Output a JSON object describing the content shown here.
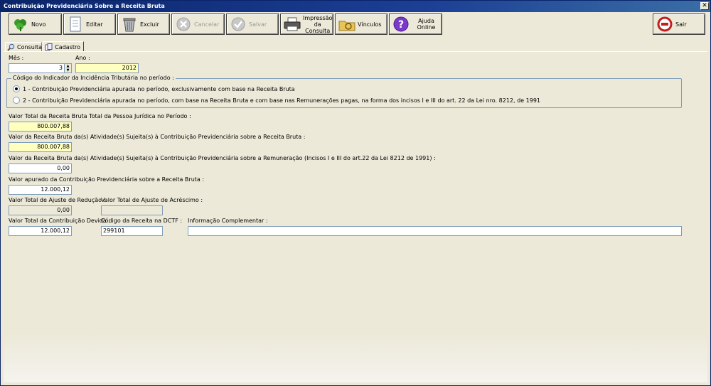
{
  "window": {
    "title": "Contribuição Previdenciária Sobre a Receita Bruta",
    "close_glyph": "✕"
  },
  "toolbar": {
    "novo": "Novo",
    "editar": "Editar",
    "excluir": "Excluir",
    "cancelar": "Cancelar",
    "salvar": "Salvar",
    "impressao_line1": "Impressão",
    "impressao_line2": "da Consulta",
    "vinculos": "Vínculos",
    "ajuda": "Ajuda Online",
    "sair": "Sair"
  },
  "tabs": {
    "consulta": "Consulta",
    "cadastro": "Cadastro"
  },
  "form": {
    "mes_label": "Mês :",
    "mes_value": "3",
    "ano_label": "Ano :",
    "ano_value": "2012",
    "indicador": {
      "legend": "Código do Indicador da Incidência Tributária no período :",
      "option1": "1 - Contribuição Previdenciária apurada no período, exclusivamente com base na Receita Bruta",
      "option2": "2 - Contribuição Previdenciária apurada no período, com base na Receita Bruta e com base nas Remunerações pagas, na forma dos  incisos I e III do art. 22 da Lei nro. 8212, de 1991",
      "selected": 1
    },
    "receita_total_label": "Valor Total da Receita Bruta Total da Pessoa Jurídica no Período :",
    "receita_total_value": "800.007,88",
    "receita_atividades_label": "Valor da Receita Bruta da(s) Atividade(s) Sujeita(s) à Contribuição Previdenciária sobre a Receita Bruta :",
    "receita_atividades_value": "800.007,88",
    "receita_remuneracao_label": "Valor da Receita Bruta da(s) Atividade(s) Sujeita(s) à Contribuição Previdenciária sobre a Remuneração (Incisos I e III do art.22 da Lei 8212 de 1991) :",
    "receita_remuneracao_value": "0,00",
    "valor_apurado_label": "Valor apurado da Contribuição Previdenciária sobre a Receita Bruta :",
    "valor_apurado_value": "12.000,12",
    "ajuste_reducao_label": "Valor Total de Ajuste de Redução :",
    "ajuste_reducao_value": "0,00",
    "ajuste_acrescimo_label": "Valor Total de Ajuste de Acréscimo :",
    "ajuste_acrescimo_value": "",
    "contribuicao_devida_label": "Valor Total da Contribuição Devida :",
    "contribuicao_devida_value": "12.000,12",
    "codigo_receita_label": "Código da Receita na DCTF :",
    "codigo_receita_value": "299101",
    "info_complementar_label": "Informação Complementar :",
    "info_complementar_value": ""
  }
}
